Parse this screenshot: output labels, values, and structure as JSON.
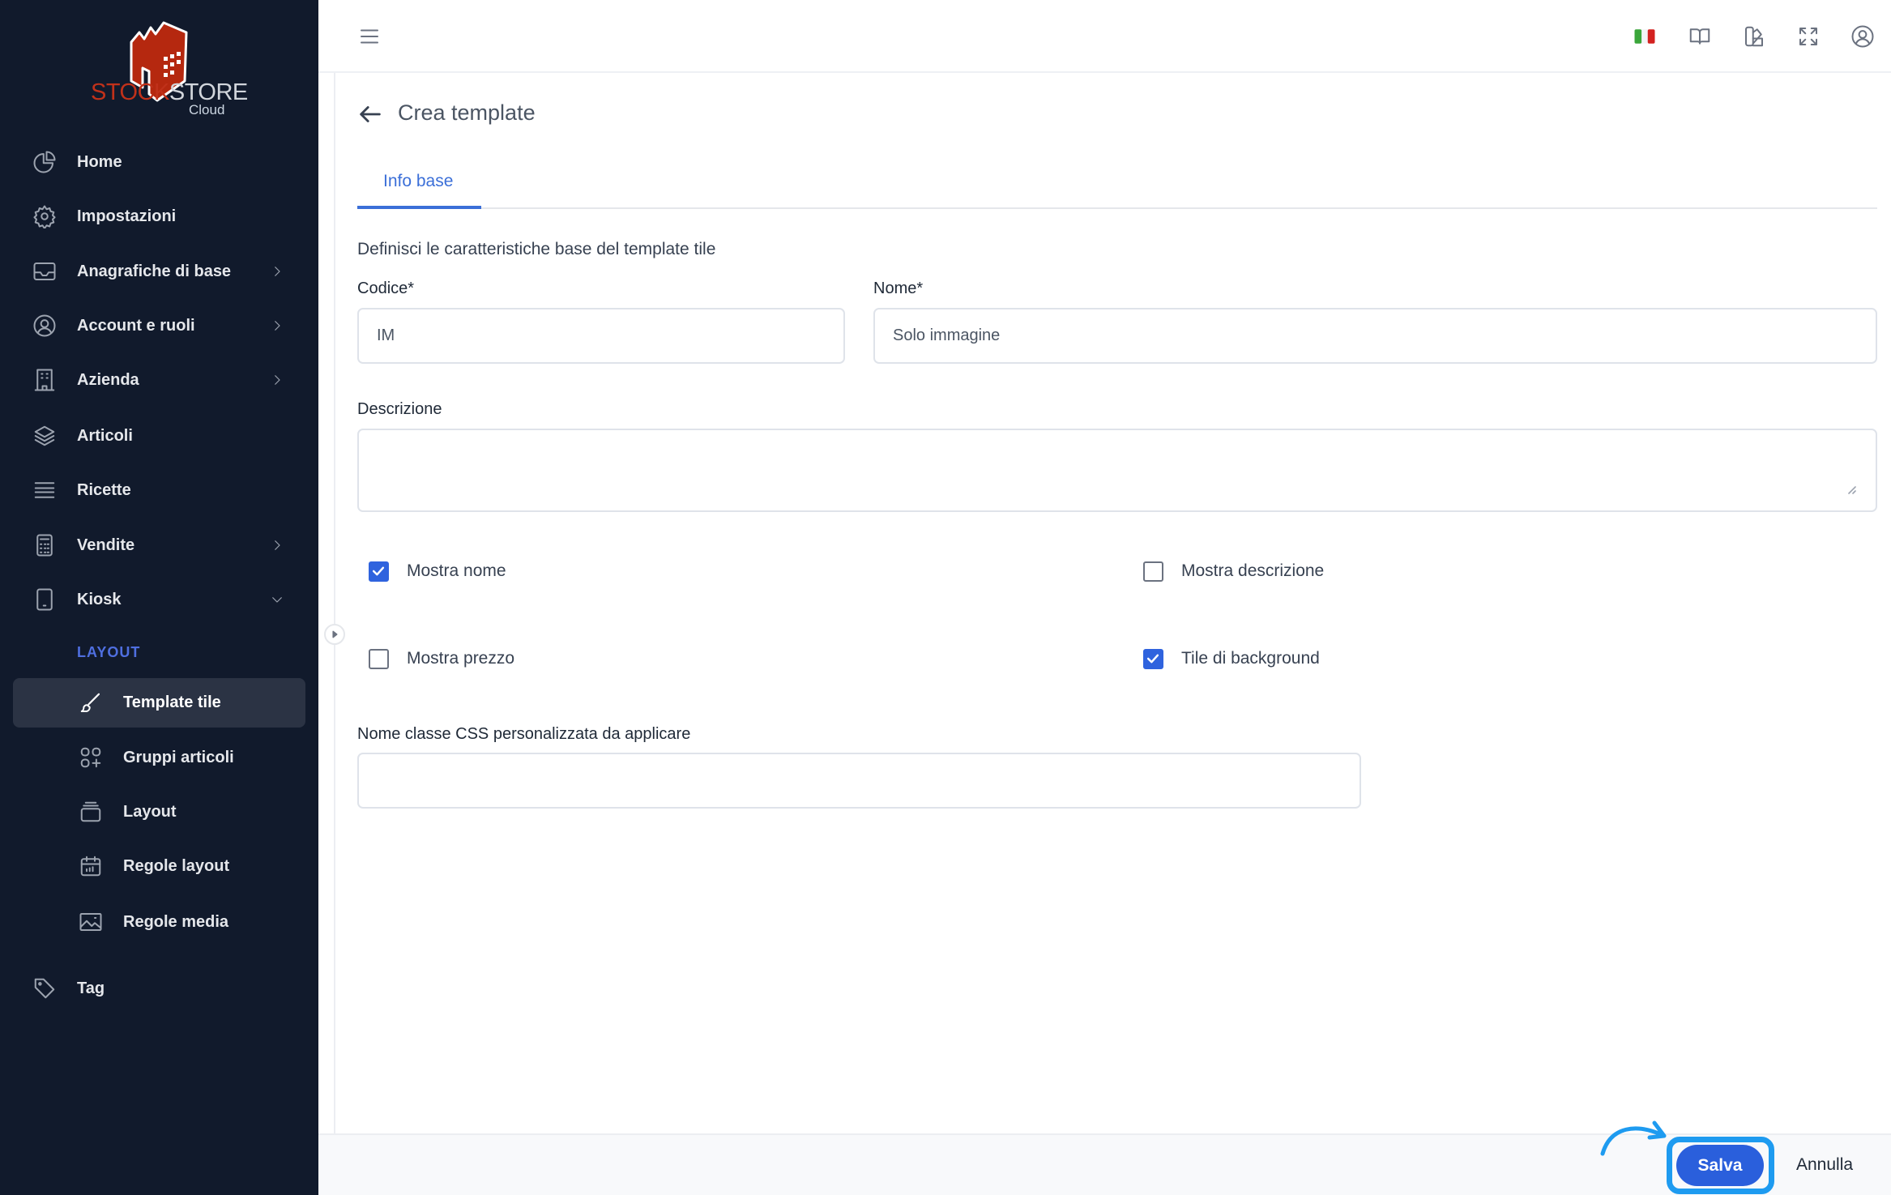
{
  "brand": {
    "name_part1": "STOCK",
    "name_part2": "STORE",
    "suffix": "Cloud",
    "colors": {
      "red": "#c0311a",
      "gray": "#d1d5db"
    }
  },
  "sidebar": {
    "items": [
      {
        "label": "Home",
        "icon": "pie-chart-icon"
      },
      {
        "label": "Impostazioni",
        "icon": "gear-icon"
      },
      {
        "label": "Anagrafiche di base",
        "icon": "inbox-icon",
        "chevron": "right"
      },
      {
        "label": "Account e ruoli",
        "icon": "user-circle-icon",
        "chevron": "right"
      },
      {
        "label": "Azienda",
        "icon": "building-icon",
        "chevron": "right"
      },
      {
        "label": "Articoli",
        "icon": "layers-icon"
      },
      {
        "label": "Ricette",
        "icon": "list-icon"
      },
      {
        "label": "Vendite",
        "icon": "calculator-icon",
        "chevron": "right"
      },
      {
        "label": "Kiosk",
        "icon": "tablet-icon",
        "chevron": "down",
        "expanded": true
      }
    ],
    "section_label": "LAYOUT",
    "sub_items": [
      {
        "label": "Template tile",
        "icon": "brush-icon",
        "active": true
      },
      {
        "label": "Gruppi articoli",
        "icon": "grid-plus-icon"
      },
      {
        "label": "Layout",
        "icon": "stack-icon"
      },
      {
        "label": "Regole layout",
        "icon": "calendar-icon"
      },
      {
        "label": "Regole media",
        "icon": "image-icon"
      }
    ],
    "tail_items": [
      {
        "label": "Tag",
        "icon": "tag-icon"
      }
    ]
  },
  "header": {
    "icons": [
      "menu-icon",
      "italian-flag-icon",
      "book-icon",
      "swatch-icon",
      "fullscreen-icon",
      "account-icon"
    ]
  },
  "page": {
    "title": "Crea template",
    "tabs": [
      {
        "label": "Info base",
        "active": true
      }
    ],
    "description": "Definisci le caratteristiche base del template tile",
    "fields": {
      "codice": {
        "label": "Codice*",
        "value": "IM"
      },
      "nome": {
        "label": "Nome*",
        "value": "Solo immagine"
      },
      "descrizione": {
        "label": "Descrizione",
        "value": ""
      },
      "css": {
        "label": "Nome classe CSS personalizzata da applicare",
        "value": ""
      }
    },
    "checkboxes": [
      {
        "label": "Mostra nome",
        "checked": true
      },
      {
        "label": "Mostra descrizione",
        "checked": false
      },
      {
        "label": "Mostra prezzo",
        "checked": false
      },
      {
        "label": "Tile di background",
        "checked": true
      }
    ]
  },
  "footer": {
    "save_label": "Salva",
    "cancel_label": "Annulla"
  },
  "colors": {
    "accent": "#2a5fdc",
    "sidebar_bg": "#111a2c",
    "highlight": "#1e9bf0"
  }
}
